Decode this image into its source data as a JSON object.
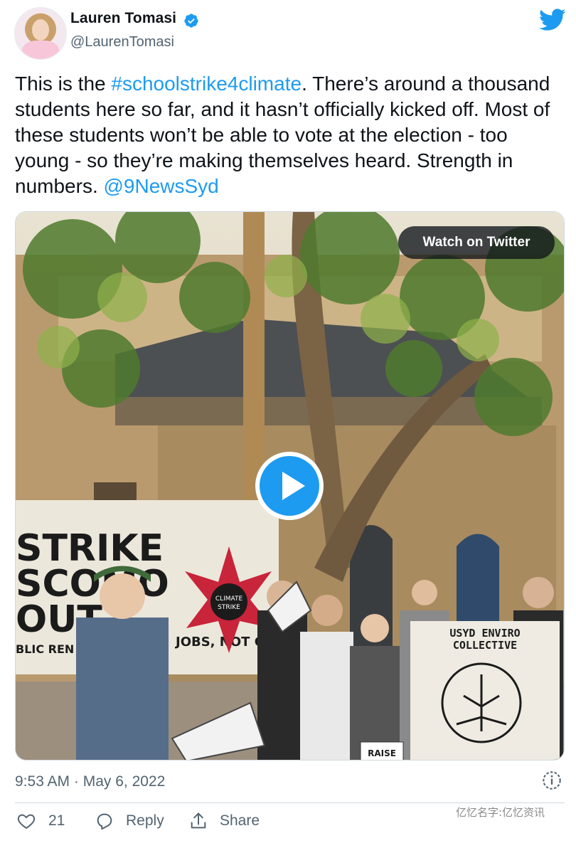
{
  "author": {
    "name": "Lauren Tomasi",
    "handle": "@LaurenTomasi"
  },
  "tweet": {
    "text_before": "This is the ",
    "hashtag": "#schoolstrike4climate",
    "text_middle": ". There’s around a thousand students here so far, and it hasn’t officially kicked off. Most of these students won’t be able to vote at the election - too young - so they’re making themselves heard. Strength in numbers. ",
    "mention": "@9NewsSyd"
  },
  "media": {
    "watch_label": "Watch on Twitter",
    "banner_left_lines": [
      "STRIKE",
      "SCOMO",
      "OUT"
    ],
    "banner_left_bottom": "BLIC REN",
    "banner_jobs": "JOBS, NOT GAS",
    "badge_line1": "CLIMATE",
    "badge_line2": "STRIKE",
    "banner_right_line1": "USYD ENVIRO",
    "banner_right_line2": "COLLECTIVE",
    "sign_text": "RAISE"
  },
  "meta": {
    "timestamp": "9:53 AM · May 6, 2022"
  },
  "actions": {
    "likes_count": "21",
    "reply_label": "Reply",
    "share_label": "Share"
  },
  "watermark": "亿忆名字:亿忆资讯",
  "colors": {
    "link": "#1d9bf0",
    "verified": "#1d9bf0",
    "secondary_text": "#536471"
  }
}
